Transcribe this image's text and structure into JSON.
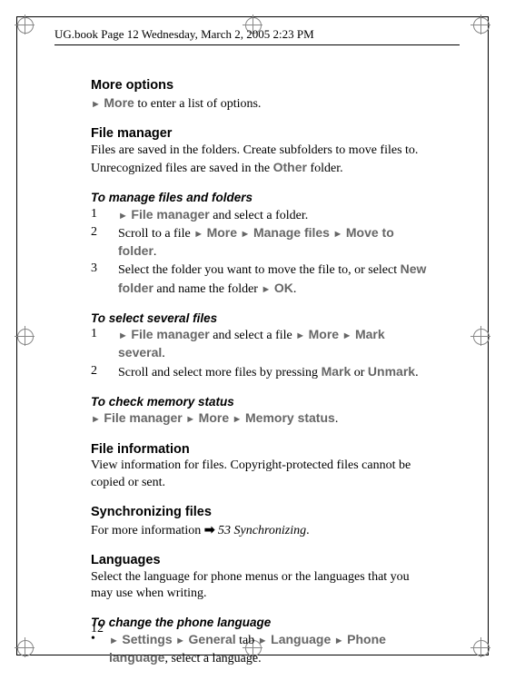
{
  "header": "UG.book  Page 12  Wednesday, March 2, 2005  2:23 PM",
  "page_number": "12",
  "arrow": "►",
  "bullet": "•",
  "ref_arrow": "➡",
  "s1": {
    "title": "More options",
    "more": "More",
    "text": " to enter a list of options."
  },
  "s2": {
    "title": "File manager",
    "text1": "Files are saved in the folders. Create subfolders to move files to. Unrecognized files are saved in the ",
    "other": "Other",
    "text2": " folder."
  },
  "s3": {
    "title": "To manage files and folders",
    "n1": "1",
    "i1a": "File manager",
    "i1b": " and select a folder.",
    "n2": "2",
    "i2a": "Scroll to a file ",
    "i2_more": "More",
    "i2_mf": "Manage files",
    "i2_mtf": "Move to folder",
    "dot": ".",
    "n3": "3",
    "i3a": "Select the folder you want to move the file to, or select ",
    "i3_nf": "New folder",
    "i3b": " and name the folder ",
    "i3_ok": "OK"
  },
  "s4": {
    "title": "To select several files",
    "n1": "1",
    "i1a": "File manager",
    "i1b": " and select a file ",
    "i1_more": "More",
    "i1_ms": "Mark several",
    "dot": ".",
    "n2": "2",
    "i2a": "Scroll and select more files by pressing ",
    "i2_mark": "Mark",
    "i2_or": " or ",
    "i2_unmark": "Unmark"
  },
  "s5": {
    "title": "To check memory status",
    "fm": "File manager",
    "more": "More",
    "ms": "Memory status",
    "dot": "."
  },
  "s6": {
    "title": "File information",
    "text": "View information for files. Copyright-protected files cannot be copied or sent."
  },
  "s7": {
    "title": "Synchronizing files",
    "text1": "For more information ",
    "ref": " 53 Synchronizing",
    "dot": "."
  },
  "s8": {
    "title": "Languages",
    "text": "Select the language for phone menus or the languages that you may use when writing."
  },
  "s9": {
    "title": "To change the phone language",
    "settings": "Settings",
    "general": "General",
    "tab": " tab ",
    "language": "Language",
    "phone_lang": "Phone language",
    "text": ", select a language."
  }
}
